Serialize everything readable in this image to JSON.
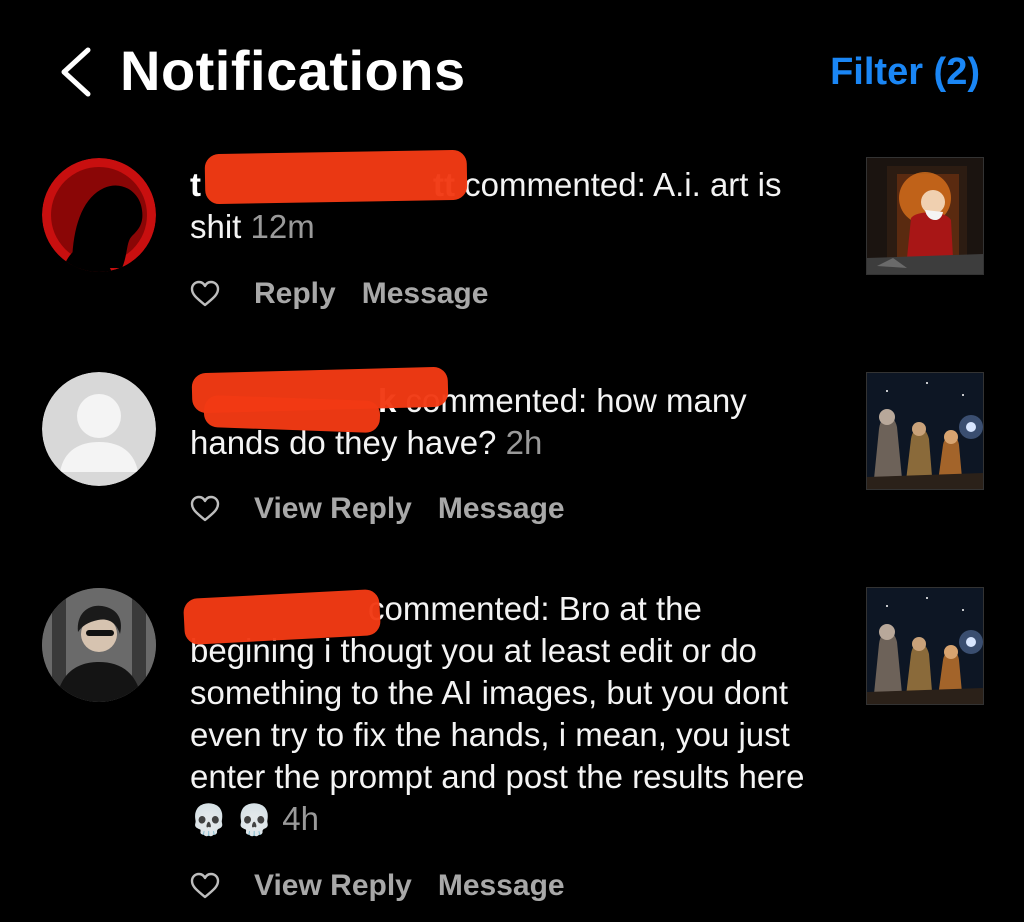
{
  "header": {
    "title": "Notifications",
    "filter_label": "Filter (2)"
  },
  "notifications": [
    {
      "username_start": "t",
      "username_end": "tt",
      "comment_prefix": " commented: ",
      "comment": "A.i. art is shit",
      "time": "12m",
      "actions": {
        "reply": "Reply",
        "message": "Message"
      }
    },
    {
      "username_start": "",
      "username_end": "k",
      "comment_prefix": " commented: ",
      "comment": "how many hands do they have?",
      "time": "2h",
      "actions": {
        "reply": "View Reply",
        "message": "Message"
      }
    },
    {
      "username_start": "",
      "username_end": "",
      "comment_prefix": "commented: ",
      "comment": "Bro at the begining i thougt you at least edit or do something to the AI images, but you dont even try to fix the hands, i mean, you just enter the prompt and post the results here",
      "emoji": "💀 💀",
      "time": "4h",
      "actions": {
        "reply": "View Reply",
        "message": "Message"
      }
    }
  ],
  "colors": {
    "accent": "#1a86f5",
    "redaction": "#f23a14",
    "muted": "#9a9a9a"
  }
}
